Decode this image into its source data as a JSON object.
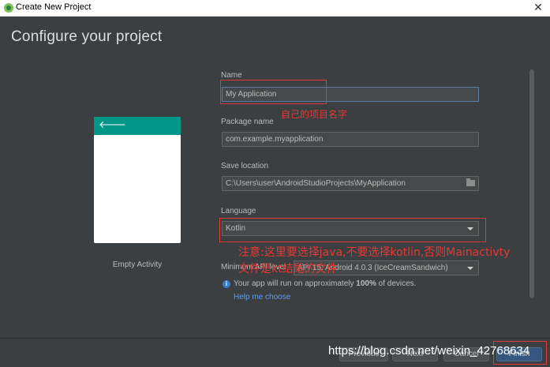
{
  "window": {
    "title": "Create New Project",
    "close_glyph": "✕"
  },
  "page": {
    "heading": "Configure your project"
  },
  "preview": {
    "template_name": "Empty Activity",
    "back_glyph": "🡐"
  },
  "form": {
    "name": {
      "label": "Name",
      "value": "My Application"
    },
    "package": {
      "label": "Package name",
      "value": "com.example.myapplication"
    },
    "save_location": {
      "label": "Save location",
      "value": "C:\\Users\\user\\AndroidStudioProjects\\MyApplication"
    },
    "language": {
      "label": "Language",
      "value": "Kotlin"
    },
    "min_api": {
      "label": "Minimum API level",
      "value": "API 15: Android 4.0.3 (IceCreamSandwich)"
    }
  },
  "info": {
    "text_prefix": "Your app will run on approximately ",
    "percent": "100%",
    "text_suffix": " of devices.",
    "help_link": "Help me choose"
  },
  "footer": {
    "previous": "Previous",
    "next": "Next",
    "cancel": "Cancel",
    "finish": "Finish"
  },
  "annotations": {
    "name_note": "自己的项目名字",
    "language_note_line1": "注意:这里要选择java,不要选择kotlin,否则Mainactivty",
    "language_note_line2": "文件是kt结尾的文件"
  },
  "watermark": "https://blog.csdn.net/weixin_42768634",
  "colors": {
    "accent": "#009688",
    "annotation": "#e53935",
    "link": "#589df6",
    "background": "#3c3f41"
  }
}
